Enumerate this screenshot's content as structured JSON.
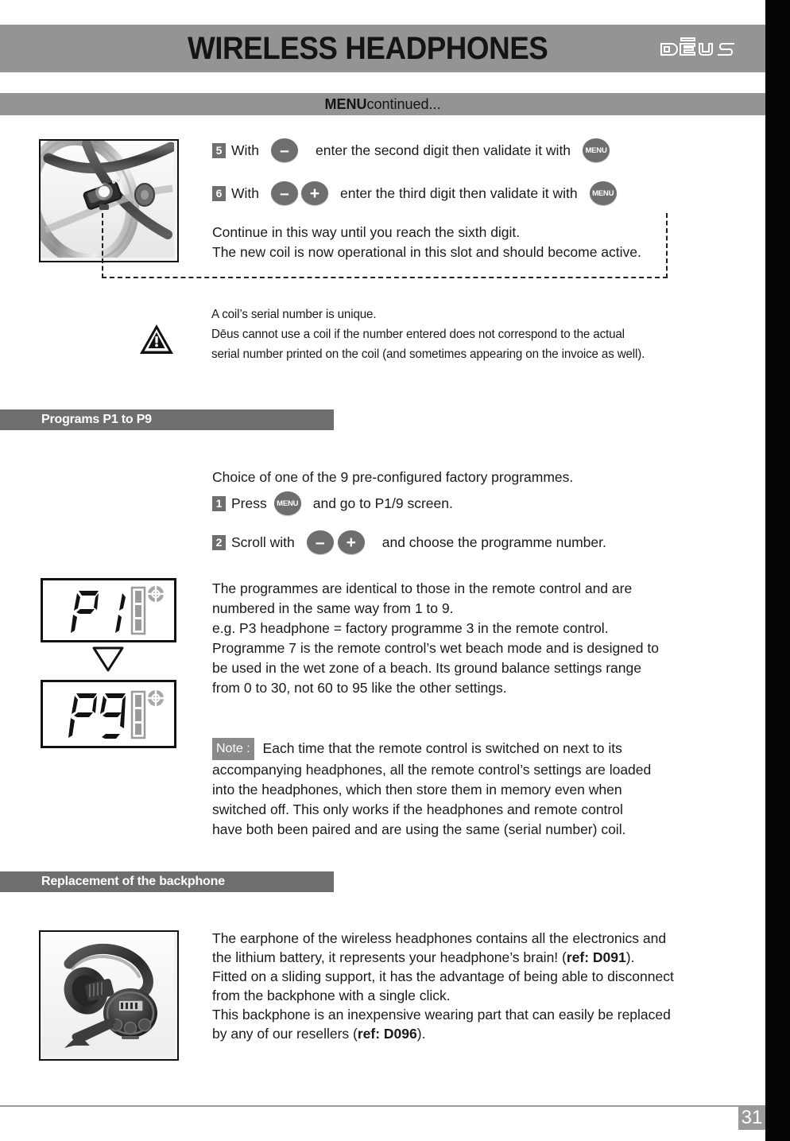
{
  "header": {
    "title": "WIRELESS HEADPHONES",
    "logo_text": "DEUS",
    "logo_name": "deus-logo"
  },
  "menu_bar": {
    "strong": "MENU",
    "rest": " continued..."
  },
  "callout_photo": {
    "alt": "coil-search-head-photo"
  },
  "steps_top": [
    {
      "number": "5",
      "lead": "With",
      "buttons": [
        "minus"
      ],
      "text": "enter the second digit then validate it with",
      "end_button": "MENU"
    },
    {
      "number": "6",
      "lead": "With",
      "buttons": [
        "minus",
        "plus"
      ],
      "text": "enter the third digit then validate it with",
      "end_button": "MENU"
    }
  ],
  "continue_text": {
    "line1": "Continue in this way until you reach the sixth digit.",
    "line2": "The new coil is now operational in this slot and should become active."
  },
  "warning": {
    "icon": "warning-triangle-icon",
    "line1": "A coil’s serial number is unique.",
    "line2": "Dēus cannot use a coil if the number entered does not correspond to the actual",
    "line3": "serial number printed on the coil (and sometimes appearing on the invoice as well)."
  },
  "programs_section": {
    "heading": "Programs P1 to P9",
    "intro": "Choice of one of the 9 pre-configured factory programmes.",
    "steps": [
      {
        "number": "1",
        "lead": "Press",
        "buttons": [
          "MENU"
        ],
        "text": "and go to P1/9 screen."
      },
      {
        "number": "2",
        "lead": "Scroll with",
        "buttons": [
          "minus",
          "plus"
        ],
        "text": "and choose the programme number."
      }
    ],
    "lcd_top": {
      "value": "P1",
      "battery_icon": "battery-indicator-icon",
      "target_icon": "target-crosshair-icon"
    },
    "lcd_bottom": {
      "value": "P9",
      "battery_icon": "battery-indicator-icon",
      "target_icon": "target-crosshair-icon"
    },
    "arrow": "down-triangle-arrow-icon",
    "body": "The programmes are identical to those in the remote control and are numbered in the same way from 1 to 9.\ne.g. P3 headphone = factory programme 3 in the remote control.\nProgramme 7 is the remote control’s wet beach mode and is designed to be used in the wet zone of a beach. Its ground balance settings range from 0 to 30, not 60 to 95 like the other settings.",
    "body_lines": [
      "The programmes are identical to those in the remote control and are",
      "numbered in the same way from 1 to 9.",
      "e.g. P3 headphone = factory programme 3 in the remote control.",
      "Programme 7 is the remote control’s wet beach mode and is designed to",
      "be used in the wet zone of a beach. Its ground balance settings range",
      "from 0 to 30, not 60 to 95 like the other settings."
    ],
    "note_label": "Note :",
    "note_lines": [
      " Each time that the remote control is switched on next to its",
      "accompanying headphones, all the remote control’s settings are loaded",
      "into the headphones, which then store them in memory even when",
      "switched off. This only works if the headphones and remote control",
      "have both been paired and are using the same (serial number) coil."
    ]
  },
  "backphone_section": {
    "heading": "Replacement of the backphone",
    "photo_alt": "wireless-headphone-photo",
    "lines": [
      "The earphone of the wireless headphones contains all the electronics and",
      "the lithium battery, it represents your headphone’s brain! (",
      "Fitted on a sliding support, it has the advantage of being able to disconnect",
      "from the backphone with a single click.",
      "This backphone is an inexpensive wearing part that can easily be replaced",
      "by any of our resellers ("
    ],
    "ref1": "ref: D091",
    "ref2": "ref: D096"
  },
  "footer": {
    "page_number": "31"
  },
  "colors": {
    "header_gray": "#949494",
    "section_gray": "#6e6e6e",
    "spine_black": "#050505",
    "page_num_gray": "#9a9a9a",
    "text_black": "#1a1a1a"
  }
}
